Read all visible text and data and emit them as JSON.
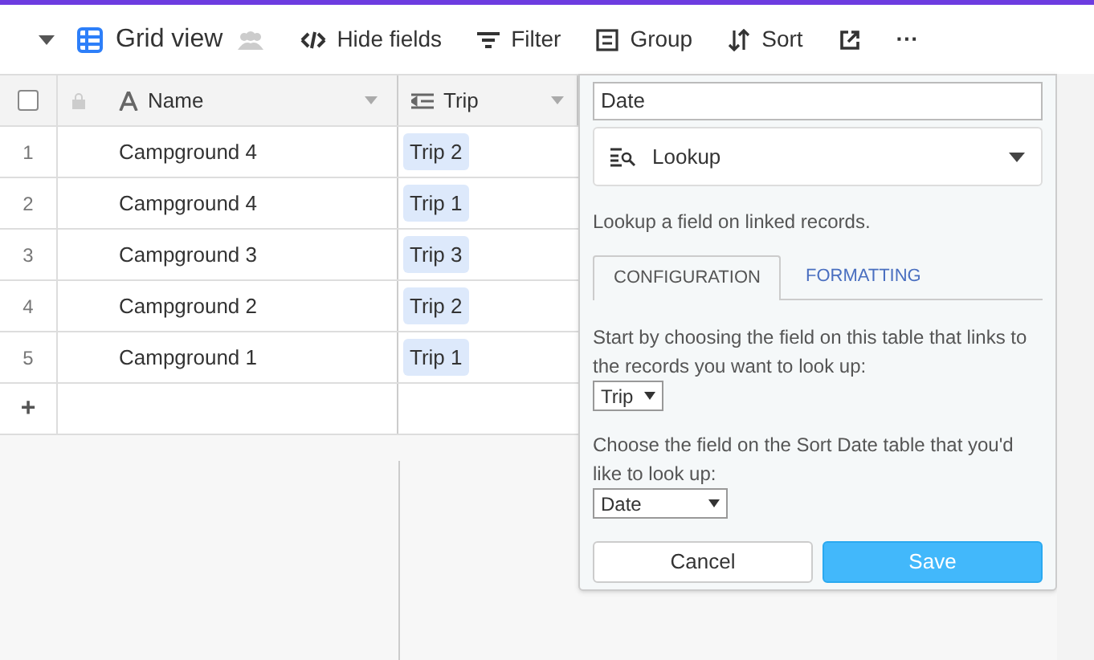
{
  "toolbar": {
    "view_name": "Grid view",
    "buttons": [
      {
        "kind": "hide",
        "label": "Hide fields"
      },
      {
        "kind": "filter",
        "label": "Filter"
      },
      {
        "kind": "group",
        "label": "Group"
      },
      {
        "kind": "sort",
        "label": "Sort"
      },
      {
        "kind": "share"
      },
      {
        "kind": "more",
        "label": "···"
      }
    ]
  },
  "table": {
    "select_all_checked": false,
    "columns": [
      {
        "kind": "text",
        "label": "Name"
      },
      {
        "kind": "link",
        "label": "Trip"
      }
    ],
    "rows": [
      {
        "number": "1",
        "name": "Campground 4",
        "trip": "Trip 2"
      },
      {
        "number": "2",
        "name": "Campground 4",
        "trip": "Trip 1"
      },
      {
        "number": "3",
        "name": "Campground 3",
        "trip": "Trip 3"
      },
      {
        "number": "4",
        "name": "Campground 2",
        "trip": "Trip 2"
      },
      {
        "number": "5",
        "name": "Campground 1",
        "trip": "Trip 1"
      }
    ],
    "add_row": "+"
  },
  "field_editor": {
    "field_name": "Date",
    "field_type": "Lookup",
    "description": "Lookup a field on linked records.",
    "tabs": [
      {
        "label": "CONFIGURATION",
        "selected": true
      },
      {
        "label": "FORMATTING",
        "selected": false
      }
    ],
    "link_prompt": "Start by choosing the field on this table that links to the records you want to look up:",
    "link_value": "Trip",
    "lookup_prompt": "Choose the field on the Sort Date table that you'd like to look up:",
    "lookup_value": "Date",
    "cancel": "Cancel",
    "save": "Save"
  }
}
